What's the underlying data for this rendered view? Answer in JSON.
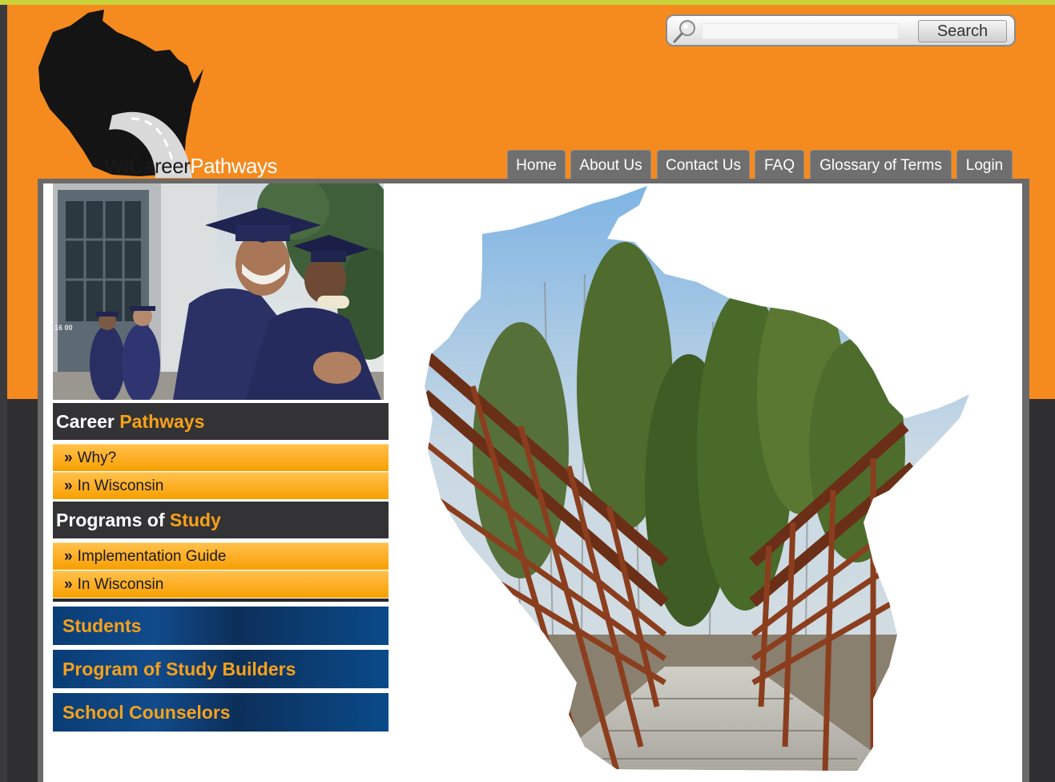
{
  "brand": {
    "logo_part1": "WICareer",
    "logo_part2": "Pathways"
  },
  "search": {
    "placeholder": "",
    "button_label": "Search"
  },
  "nav": {
    "items": [
      {
        "label": "Home"
      },
      {
        "label": "About Us"
      },
      {
        "label": "Contact Us"
      },
      {
        "label": "FAQ"
      },
      {
        "label": "Glossary of Terms"
      },
      {
        "label": "Login"
      }
    ]
  },
  "sidebar": {
    "career_pathways": {
      "title_part1": "Career",
      "title_part2": "Pathways",
      "links": [
        {
          "label": "Why?"
        },
        {
          "label": "In Wisconsin"
        }
      ]
    },
    "programs_of_study": {
      "title_part1": "Programs of",
      "title_part2": "Study",
      "links": [
        {
          "label": "Implementation Guide"
        },
        {
          "label": "In Wisconsin"
        }
      ]
    },
    "buttons": [
      {
        "label": "Students"
      },
      {
        "label": "Program of Study Builders"
      },
      {
        "label": "School Counselors"
      }
    ]
  },
  "images": {
    "photo_sign": "16 00"
  },
  "colors": {
    "orange": "#f58a1f",
    "accent_orange": "#f7a11a",
    "dark": "#2f2f31",
    "blue": "#0a3d75",
    "tab_gray": "#6f6f6f"
  },
  "icons": {
    "search": "magnifier-icon",
    "chevron": "double-chevron-right-icon"
  }
}
